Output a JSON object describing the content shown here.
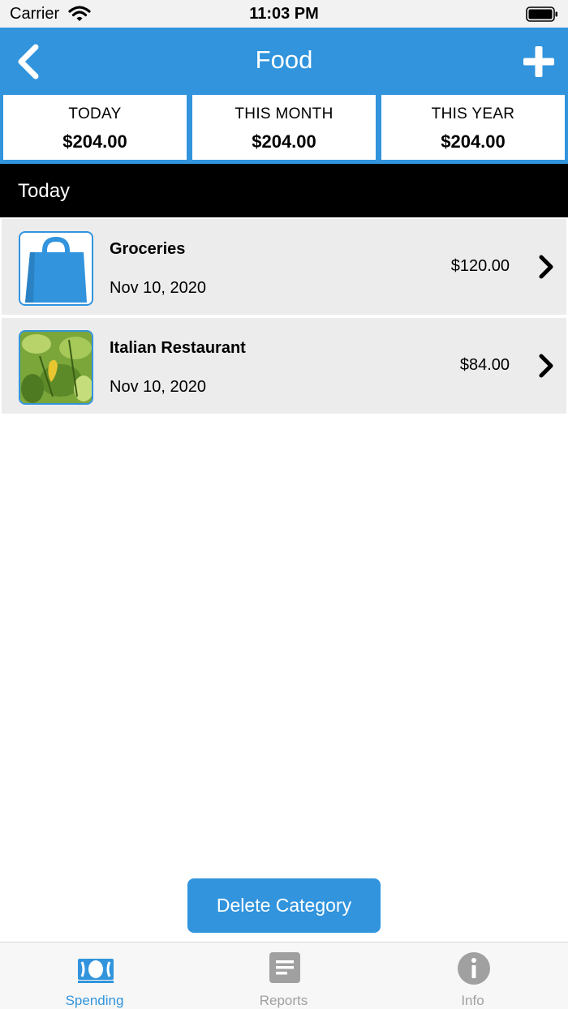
{
  "status_bar": {
    "carrier": "Carrier",
    "time": "11:03 PM"
  },
  "nav": {
    "title": "Food",
    "back_icon": "chevron-left-icon",
    "add_icon": "plus-icon"
  },
  "summary": [
    {
      "label": "TODAY",
      "value": "$204.00"
    },
    {
      "label": "THIS MONTH",
      "value": "$204.00"
    },
    {
      "label": "THIS YEAR",
      "value": "$204.00"
    }
  ],
  "section": {
    "title": "Today"
  },
  "transactions": [
    {
      "name": "Groceries",
      "date": "Nov 10, 2020",
      "amount": "$120.00",
      "icon": "shopping-bag-icon"
    },
    {
      "name": "Italian Restaurant",
      "date": "Nov 10, 2020",
      "amount": "$84.00",
      "icon": "leaves-photo"
    }
  ],
  "actions": {
    "delete_label": "Delete Category"
  },
  "tabs": [
    {
      "label": "Spending",
      "icon": "money-icon",
      "active": true
    },
    {
      "label": "Reports",
      "icon": "report-icon",
      "active": false
    },
    {
      "label": "Info",
      "icon": "info-icon",
      "active": false
    }
  ],
  "colors": {
    "accent": "#3194dd",
    "row_bg": "#ececec",
    "section_bg": "#000000",
    "inactive_tab": "#a0a0a0"
  }
}
